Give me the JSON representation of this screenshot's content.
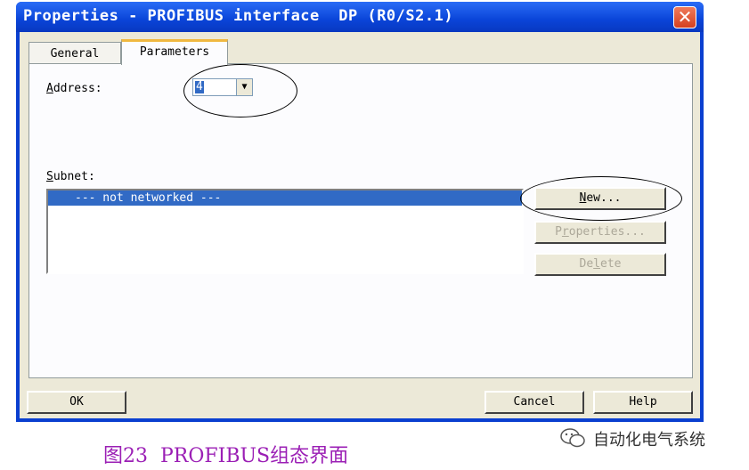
{
  "window": {
    "title": "Properties - PROFIBUS interface  DP (R0/S2.1)",
    "close_glyph": "✕"
  },
  "tabs": [
    {
      "label": "General",
      "selected": false
    },
    {
      "label": "Parameters",
      "selected": true
    }
  ],
  "address": {
    "label_accel": "A",
    "label_rest": "ddress:",
    "value": "4"
  },
  "subnet": {
    "label_accel": "S",
    "label_rest": "ubnet:",
    "items": [
      "--- not networked ---"
    ],
    "selected_index": 0
  },
  "subnet_buttons": {
    "new_accel": "N",
    "new_rest": "ew...",
    "properties_pre": "P",
    "properties_accel": "r",
    "properties_rest": "operties...",
    "delete_pre": "De",
    "delete_accel": "l",
    "delete_rest": "ete"
  },
  "footer": {
    "ok": "OK",
    "cancel": "Cancel",
    "help": "Help"
  },
  "caption": "图23  PROFIBUS组态界面",
  "watermark": "自动化电气系统",
  "colors": {
    "title_bar": "#0a44d8",
    "selection": "#316ac5",
    "caption": "#9b1fb5",
    "close_button": "#d44020"
  }
}
